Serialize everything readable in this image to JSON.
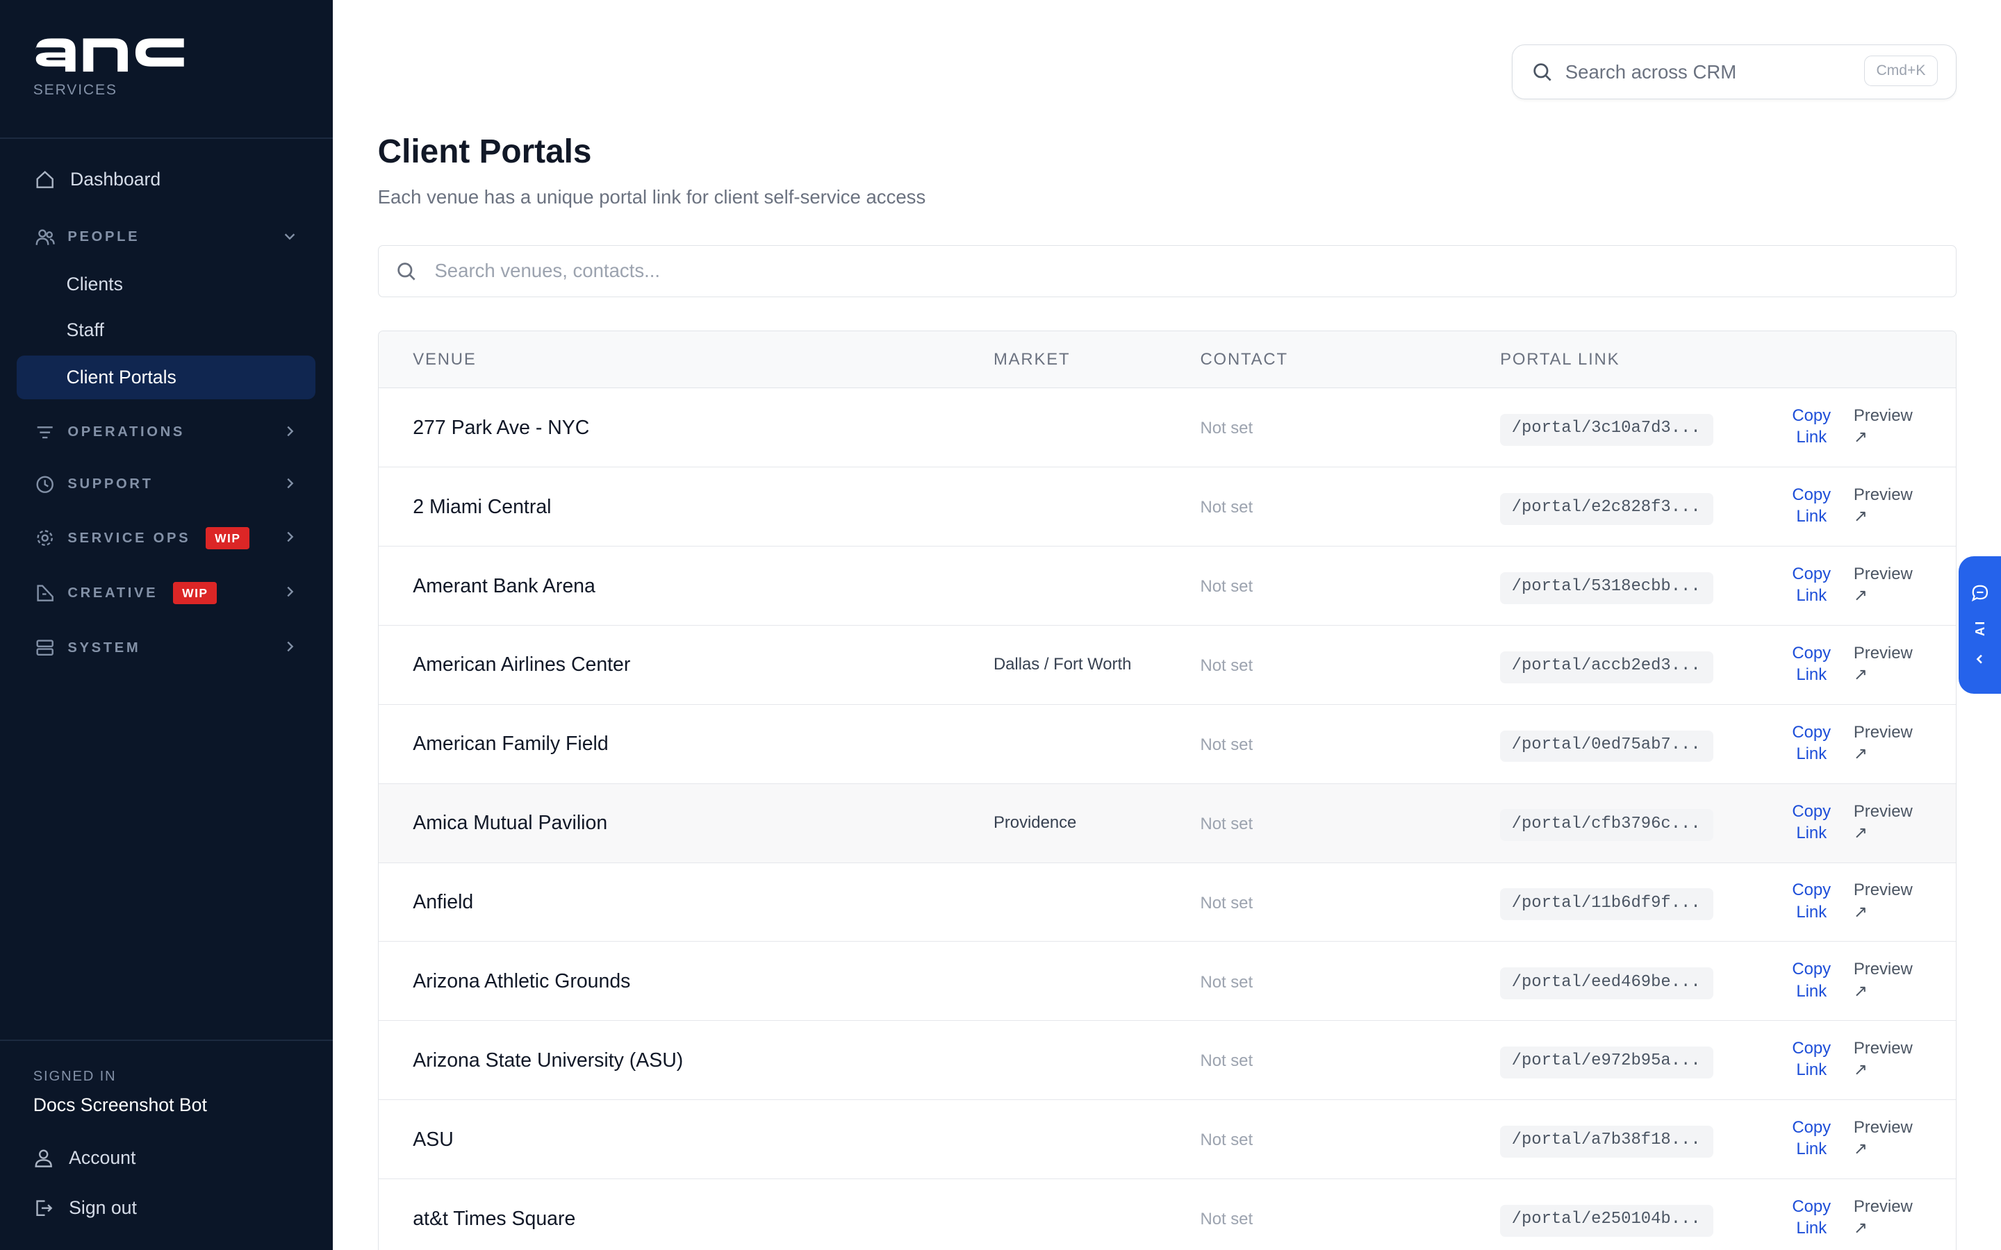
{
  "brand": {
    "logo_text": "anc",
    "subtitle": "SERVICES"
  },
  "sidebar": {
    "dashboard": "Dashboard",
    "people": {
      "label": "PEOPLE",
      "items": [
        "Clients",
        "Staff",
        "Client Portals"
      ]
    },
    "sections": [
      {
        "label": "OPERATIONS"
      },
      {
        "label": "SUPPORT"
      },
      {
        "label": "SERVICE OPS",
        "badge": "WIP"
      },
      {
        "label": "CREATIVE",
        "badge": "WIP"
      },
      {
        "label": "SYSTEM"
      }
    ],
    "signed_in_label": "SIGNED IN",
    "user_name": "Docs Screenshot Bot",
    "account": "Account",
    "sign_out": "Sign out"
  },
  "header": {
    "search_placeholder": "Search across CRM",
    "shortcut": "Cmd+K"
  },
  "page": {
    "title": "Client Portals",
    "subtitle": "Each venue has a unique portal link for client self-service access",
    "search_placeholder": "Search venues, contacts..."
  },
  "table": {
    "columns": [
      "VENUE",
      "MARKET",
      "CONTACT",
      "PORTAL LINK"
    ],
    "copy_label": [
      "Copy",
      "Link"
    ],
    "preview_label": [
      "Preview",
      "↗"
    ],
    "rows": [
      {
        "venue": "277 Park Ave - NYC",
        "market": "",
        "contact": "Not set",
        "link": "/portal/3c10a7d3..."
      },
      {
        "venue": "2 Miami Central",
        "market": "",
        "contact": "Not set",
        "link": "/portal/e2c828f3..."
      },
      {
        "venue": "Amerant Bank Arena",
        "market": "",
        "contact": "Not set",
        "link": "/portal/5318ecbb..."
      },
      {
        "venue": "American Airlines Center",
        "market": "Dallas / Fort Worth",
        "contact": "Not set",
        "link": "/portal/accb2ed3..."
      },
      {
        "venue": "American Family Field",
        "market": "",
        "contact": "Not set",
        "link": "/portal/0ed75ab7..."
      },
      {
        "venue": "Amica Mutual Pavilion",
        "market": "Providence",
        "contact": "Not set",
        "link": "/portal/cfb3796c..."
      },
      {
        "venue": "Anfield",
        "market": "",
        "contact": "Not set",
        "link": "/portal/11b6df9f..."
      },
      {
        "venue": "Arizona Athletic Grounds",
        "market": "",
        "contact": "Not set",
        "link": "/portal/eed469be..."
      },
      {
        "venue": "Arizona State University (ASU)",
        "market": "",
        "contact": "Not set",
        "link": "/portal/e972b95a..."
      },
      {
        "venue": "ASU",
        "market": "",
        "contact": "Not set",
        "link": "/portal/a7b38f18..."
      },
      {
        "venue": "at&t Times Square",
        "market": "",
        "contact": "Not set",
        "link": "/portal/e250104b..."
      }
    ]
  },
  "ai_tab": {
    "label": "AI"
  },
  "colors": {
    "sidebar_bg": "#0b1628",
    "active_bg": "#102650",
    "accent": "#2563eb",
    "link": "#1d4ed8",
    "badge": "#dc2626"
  },
  "icons": [
    "home-icon",
    "people-icon",
    "operations-icon",
    "support-icon",
    "service-ops-icon",
    "creative-icon",
    "system-icon",
    "user-icon",
    "sign-out-icon",
    "search-icon",
    "chat-icon",
    "chevron-icon"
  ]
}
